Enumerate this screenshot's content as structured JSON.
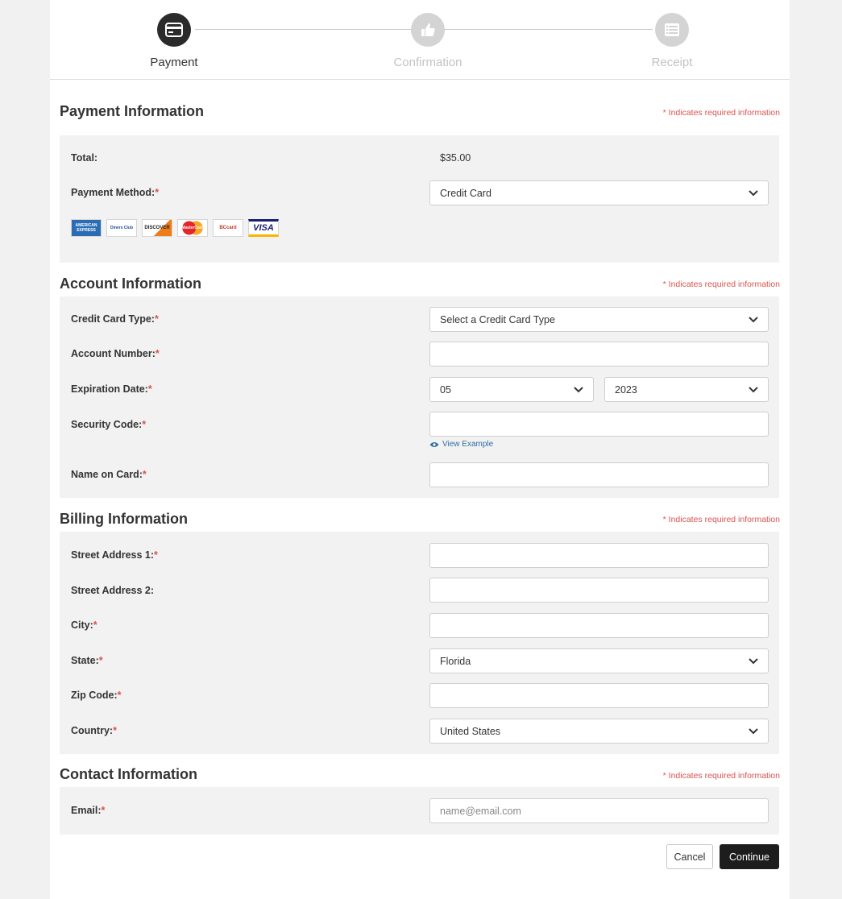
{
  "stepper": {
    "steps": [
      {
        "label": "Payment",
        "state": "active",
        "icon": "credit-card-icon"
      },
      {
        "label": "Confirmation",
        "state": "inactive",
        "icon": "thumbs-up-icon"
      },
      {
        "label": "Receipt",
        "state": "inactive",
        "icon": "list-icon"
      }
    ]
  },
  "required_note": "* Indicates required information",
  "payment": {
    "title": "Payment Information",
    "total_label": "Total:",
    "total_value": "$35.00",
    "method_label": "Payment Method:",
    "method_value": "Credit Card",
    "card_logos": [
      "AMERICAN EXPRESS",
      "Diners Club",
      "DISCOVER",
      "MasterCard",
      "BCcard",
      "VISA"
    ]
  },
  "account": {
    "title": "Account Information",
    "card_type_label": "Credit Card Type:",
    "card_type_value": "Select a Credit Card Type",
    "account_number_label": "Account Number:",
    "expiration_label": "Expiration Date:",
    "exp_month": "05",
    "exp_year": "2023",
    "security_label": "Security Code:",
    "view_example": "View Example",
    "name_label": "Name on Card:"
  },
  "billing": {
    "title": "Billing Information",
    "street1_label": "Street Address 1:",
    "street2_label": "Street Address 2:",
    "city_label": "City:",
    "state_label": "State:",
    "state_value": "Florida",
    "zip_label": "Zip Code:",
    "country_label": "Country:",
    "country_value": "United States"
  },
  "contact": {
    "title": "Contact Information",
    "email_label": "Email:",
    "email_placeholder": "name@email.com"
  },
  "actions": {
    "cancel": "Cancel",
    "continue": "Continue"
  },
  "colors": {
    "accent_dark": "#1d1d1d",
    "required": "#d9534f",
    "panel": "#f2f2f2"
  }
}
